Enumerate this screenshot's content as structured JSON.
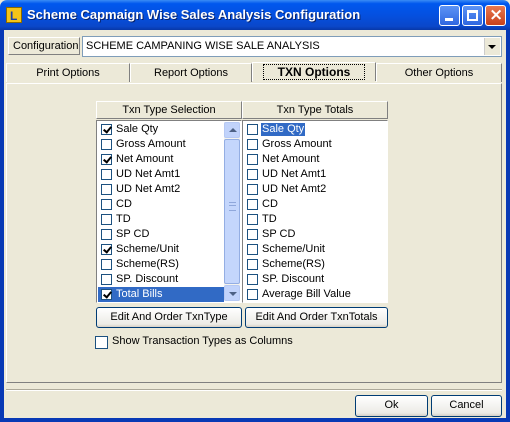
{
  "window": {
    "title": "Scheme Capmaign Wise Sales Analysis Configuration",
    "icon_letter": "L",
    "controls": [
      "minimize",
      "maximize",
      "close"
    ],
    "accent": "#0450E0",
    "close_color": "#C8411B"
  },
  "config": {
    "label": "Configuration",
    "value": "SCHEME CAMPANING WISE SALE ANALYSIS"
  },
  "tabs": [
    {
      "label": "Print Options",
      "active": false
    },
    {
      "label": "Report Options",
      "active": false
    },
    {
      "label": "TXN Options",
      "active": true
    },
    {
      "label": "Other Options",
      "active": false
    }
  ],
  "txn_selection": {
    "title": "Txn Type Selection",
    "items": [
      {
        "label": "Sale Qty",
        "checked": true,
        "selected": false
      },
      {
        "label": "Gross Amount",
        "checked": false,
        "selected": false
      },
      {
        "label": "Net Amount",
        "checked": true,
        "selected": false
      },
      {
        "label": "UD Net Amt1",
        "checked": false,
        "selected": false
      },
      {
        "label": "UD Net Amt2",
        "checked": false,
        "selected": false
      },
      {
        "label": "CD",
        "checked": false,
        "selected": false
      },
      {
        "label": "TD",
        "checked": false,
        "selected": false
      },
      {
        "label": "SP CD",
        "checked": false,
        "selected": false
      },
      {
        "label": "Scheme/Unit",
        "checked": true,
        "selected": false
      },
      {
        "label": "Scheme(RS)",
        "checked": false,
        "selected": false
      },
      {
        "label": "SP. Discount",
        "checked": false,
        "selected": false
      },
      {
        "label": "Total Bills",
        "checked": true,
        "selected": true
      }
    ],
    "edit_button": "Edit And Order TxnType"
  },
  "txn_totals": {
    "title": "Txn Type Totals",
    "items": [
      {
        "label": "Sale Qty",
        "checked": false,
        "selected": true
      },
      {
        "label": "Gross Amount",
        "checked": false,
        "selected": false
      },
      {
        "label": "Net Amount",
        "checked": false,
        "selected": false
      },
      {
        "label": "UD Net Amt1",
        "checked": false,
        "selected": false
      },
      {
        "label": "UD Net Amt2",
        "checked": false,
        "selected": false
      },
      {
        "label": "CD",
        "checked": false,
        "selected": false
      },
      {
        "label": "TD",
        "checked": false,
        "selected": false
      },
      {
        "label": "SP CD",
        "checked": false,
        "selected": false
      },
      {
        "label": "Scheme/Unit",
        "checked": false,
        "selected": false
      },
      {
        "label": "Scheme(RS)",
        "checked": false,
        "selected": false
      },
      {
        "label": "SP. Discount",
        "checked": false,
        "selected": false
      },
      {
        "label": "Average Bill Value",
        "checked": false,
        "selected": false
      }
    ],
    "edit_button": "Edit And Order TxnTotals"
  },
  "show_as_columns": {
    "label": "Show Transaction Types as Columns",
    "checked": false
  },
  "footer": {
    "ok": "Ok",
    "cancel": "Cancel"
  },
  "highlight_color": "#316AC5"
}
